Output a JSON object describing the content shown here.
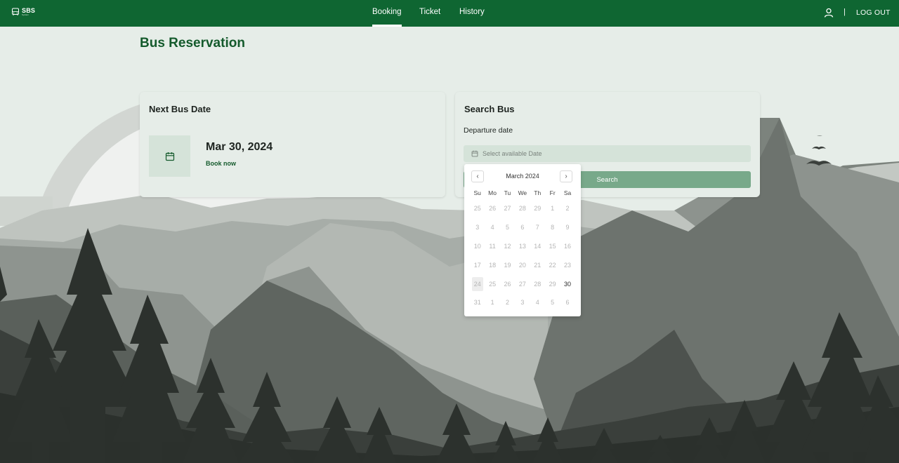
{
  "app": {
    "logo_text": "SBS",
    "logo_sub": "System"
  },
  "nav": {
    "items": [
      {
        "label": "Booking",
        "active": true
      },
      {
        "label": "Ticket",
        "active": false
      },
      {
        "label": "History",
        "active": false
      }
    ],
    "separator": "|",
    "logout_label": "LOG OUT",
    "user_icon": "user-icon"
  },
  "page": {
    "title": "Bus Reservation"
  },
  "next_bus": {
    "title": "Next Bus Date",
    "date": "Mar 30, 2024",
    "book_label": "Book now",
    "icon": "calendar-icon"
  },
  "search_bus": {
    "title": "Search Bus",
    "departure_label": "Departure date",
    "date_placeholder": "Select available Date",
    "search_label": "Search"
  },
  "calendar": {
    "month_label": "March 2024",
    "prev": "‹",
    "next": "›",
    "weekdays": [
      "Su",
      "Mo",
      "Tu",
      "We",
      "Th",
      "Fr",
      "Sa"
    ],
    "weeks": [
      [
        "25",
        "26",
        "27",
        "28",
        "29",
        "1",
        "2"
      ],
      [
        "3",
        "4",
        "5",
        "6",
        "7",
        "8",
        "9"
      ],
      [
        "10",
        "11",
        "12",
        "13",
        "14",
        "15",
        "16"
      ],
      [
        "17",
        "18",
        "19",
        "20",
        "21",
        "22",
        "23"
      ],
      [
        "24",
        "25",
        "26",
        "27",
        "28",
        "29",
        "30"
      ],
      [
        "31",
        "1",
        "2",
        "3",
        "4",
        "5",
        "6"
      ]
    ],
    "available_day": "30",
    "today": "24"
  },
  "colors": {
    "brand": "#0f6632",
    "title": "#145a2c",
    "button": "#78a98a",
    "input_bg": "#d5e3d9",
    "page_bg": "#e6ede8"
  }
}
